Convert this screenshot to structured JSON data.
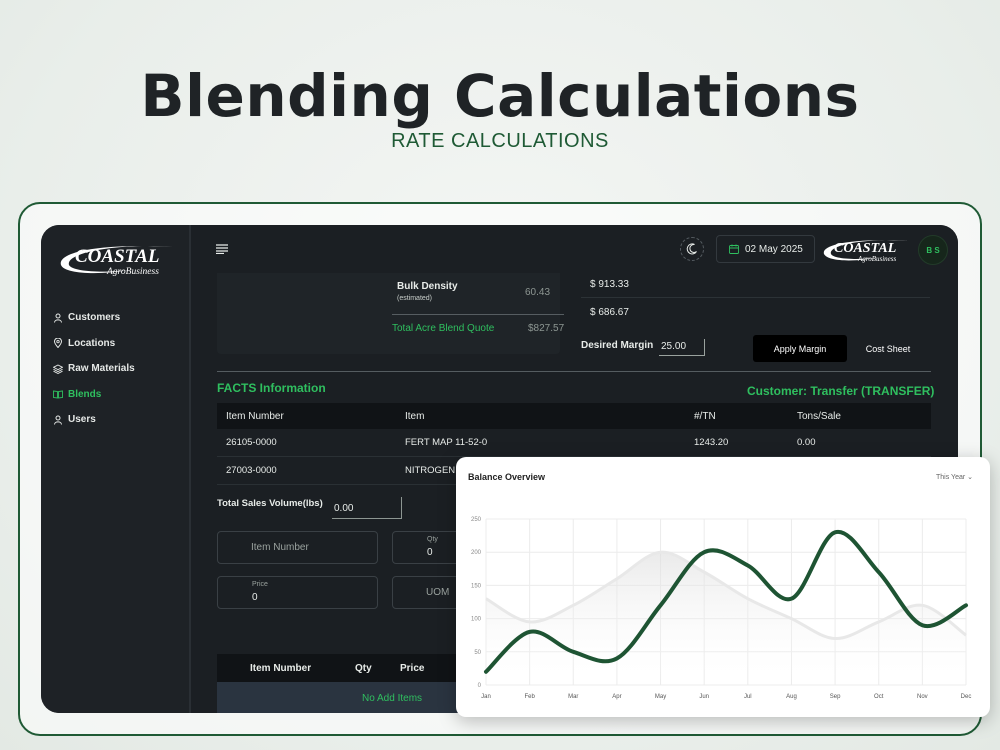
{
  "hero": {
    "title": "Blending Calculations",
    "subtitle": "RATE CALCULATIONS"
  },
  "sidebar": {
    "logo_main": "COASTAL",
    "logo_sub": "AgroBusiness",
    "items": [
      {
        "label": "Customers",
        "icon": "user-icon",
        "active": false
      },
      {
        "label": "Locations",
        "icon": "location-pin-icon",
        "active": false
      },
      {
        "label": "Raw Materials",
        "icon": "layers-icon",
        "active": false
      },
      {
        "label": "Blends",
        "icon": "book-icon",
        "active": true
      },
      {
        "label": "Users",
        "icon": "user-icon",
        "active": false
      }
    ]
  },
  "topbar": {
    "date": "02 May 2025",
    "logo_main": "COASTAL",
    "logo_sub": "AgroBusiness",
    "avatar": "B S"
  },
  "summary": {
    "bulk_density_label": "Bulk Density",
    "bulk_density_sub": "(estimated)",
    "bulk_density_value": "60.43",
    "total_label": "Total Acre Blend Quote",
    "total_value": "$827.57",
    "amount1": "$ 913.33",
    "amount2": "$ 686.67",
    "desired_margin_label": "Desired Margin",
    "desired_margin_value": "25.00",
    "apply_margin": "Apply Margin",
    "cost_sheet": "Cost Sheet"
  },
  "facts": {
    "title": "FACTS Information",
    "customer": "Customer: Transfer (TRANSFER)",
    "headers": [
      "Item Number",
      "Item",
      "#/TN",
      "Tons/Sale"
    ],
    "rows": [
      [
        "26105-0000",
        "FERT MAP 11-52-0",
        "1243.20",
        "0.00"
      ],
      [
        "27003-0000",
        "NITROGEN",
        "",
        ""
      ]
    ]
  },
  "form": {
    "total_sales_label": "Total Sales Volume(lbs)",
    "total_sales_value": "0.00",
    "item_number_placeholder": "Item Number",
    "qty_label": "Qty",
    "qty_value": "0",
    "price_label": "Price",
    "price_value": "0",
    "uom_placeholder": "UOM"
  },
  "items_table": {
    "headers": [
      "Item Number",
      "Qty",
      "Price"
    ],
    "empty": "No Add Items"
  },
  "chart_data": {
    "type": "line",
    "title": "Balance Overview",
    "filter": "This Year",
    "categories": [
      "Jan",
      "Feb",
      "Mar",
      "Apr",
      "May",
      "Jun",
      "Jul",
      "Aug",
      "Sep",
      "Oct",
      "Nov",
      "Dec"
    ],
    "ylim": [
      0,
      250
    ],
    "yticks": [
      0,
      50,
      100,
      150,
      200,
      250
    ],
    "series": [
      {
        "values": [
          20,
          80,
          50,
          40,
          120,
          200,
          180,
          130,
          230,
          170,
          90,
          120
        ],
        "color": "#1e5433"
      },
      {
        "values": [
          130,
          95,
          120,
          160,
          200,
          170,
          130,
          100,
          70,
          95,
          120,
          75
        ],
        "color": "#e8e8e8"
      }
    ]
  },
  "colors": {
    "accent": "#2fbf5f",
    "dark_green": "#1f5a35"
  }
}
